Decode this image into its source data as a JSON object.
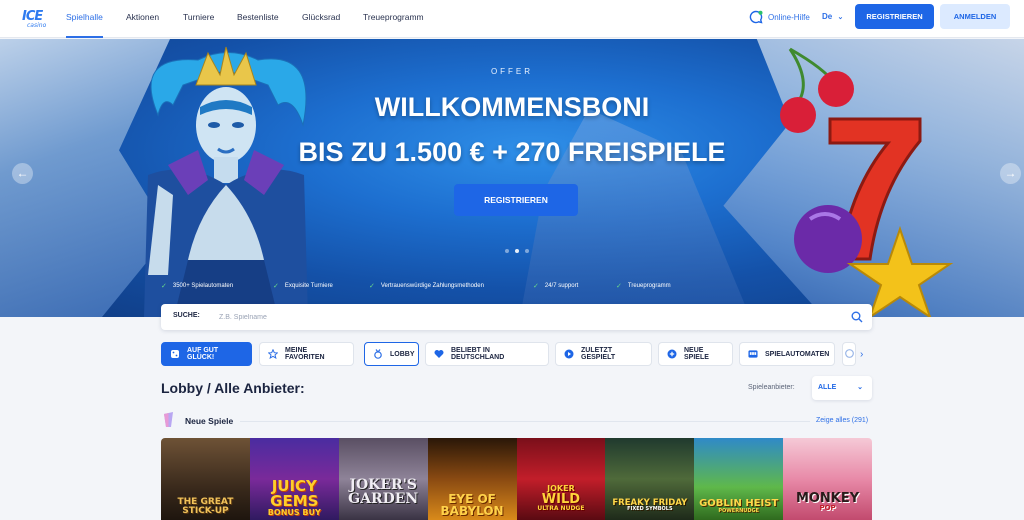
{
  "header": {
    "logo": {
      "line1": "ICE",
      "line2": "casino"
    },
    "nav": [
      "Spielhalle",
      "Aktionen",
      "Turniere",
      "Bestenliste",
      "Glücksrad",
      "Treueprogramm"
    ],
    "help": "Online-Hilfe",
    "language": "De",
    "register": "REGISTRIEREN",
    "login": "ANMELDEN"
  },
  "hero": {
    "offer": "OFFER",
    "title": "WILLKOMMENSBONI",
    "subtitle": "BIS ZU 1.500 € + 270 FREISPIELE",
    "cta": "REGISTRIEREN",
    "features": [
      "3500+ Spielautomaten",
      "Exquisite Turniere",
      "Vertrauenswürdige Zahlungsmethoden",
      "24/7 support",
      "Treueprogramm"
    ]
  },
  "search": {
    "label": "SUCHE:",
    "placeholder": "Z.B. Spielname"
  },
  "categories": [
    "AUF GUT GLÜCK!",
    "MEINE FAVORITEN",
    "LOBBY",
    "BELIEBT IN DEUTSCHLAND",
    "ZULETZT GESPIELT",
    "NEUE SPIELE",
    "SPIELAUTOMATEN"
  ],
  "lobby": {
    "title": "Lobby / Alle Anbieter:",
    "provider_label": "Spieleanbieter:",
    "provider_value": "ALLE"
  },
  "new_games": {
    "title": "Neue Spiele",
    "show_all": "Zeige alles (291)",
    "games": [
      {
        "line1": "THE GREAT",
        "line2": "STICK-UP"
      },
      {
        "line1": "JUICY",
        "line2": "GEMS",
        "line3": "BONUS BUY"
      },
      {
        "line1": "JOKER'S",
        "line2": "GARDEN"
      },
      {
        "line1": "EYE OF",
        "line2": "BABYLON"
      },
      {
        "line1": "JOKER",
        "line2": "WILD",
        "line3": "ULTRA NUDGE"
      },
      {
        "line1": "FREAKY FRIDAY",
        "line2": "FIXED SYMBOLS"
      },
      {
        "line1": "GOBLIN HEIST",
        "line2": "POWERNUDGE"
      },
      {
        "line1": "MONKEY",
        "line2": "POP"
      }
    ]
  },
  "colors": {
    "accent": "#1e66e6",
    "check": "#68d98a"
  }
}
